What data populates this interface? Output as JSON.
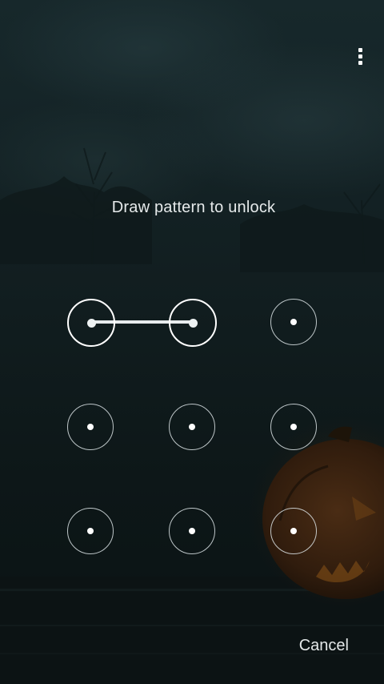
{
  "lock_screen": {
    "prompt": "Draw pattern to unlock",
    "cancel_label": "Cancel",
    "menu_icon": "overflow-menu-icon",
    "pattern": {
      "grid": [
        [
          "1",
          "2",
          "3"
        ],
        [
          "4",
          "5",
          "6"
        ],
        [
          "7",
          "8",
          "9"
        ]
      ],
      "selected_sequence": [
        "1",
        "2"
      ]
    },
    "colors": {
      "line": "#e8ecee",
      "node_ring": "#dce4e6",
      "text": "#e6eaeb"
    }
  }
}
